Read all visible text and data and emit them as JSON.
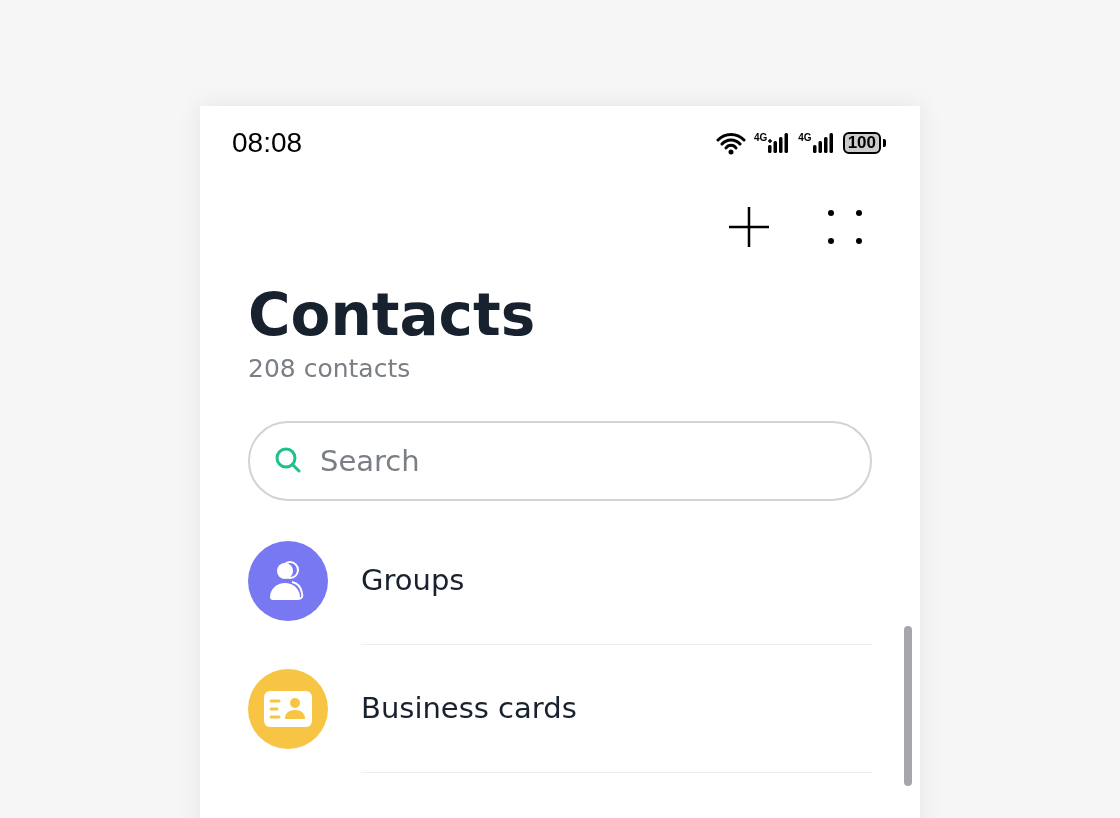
{
  "status_bar": {
    "time": "08:08",
    "sim_1": "4G",
    "sim_2": "4G",
    "battery": "100"
  },
  "title": "Contacts",
  "subtitle": "208 contacts",
  "search": {
    "placeholder": "Search"
  },
  "items": [
    {
      "kind": "groups",
      "label": "Groups",
      "color": "#7878f2"
    },
    {
      "kind": "cards",
      "label": "Business cards",
      "color": "#f8c443"
    }
  ]
}
